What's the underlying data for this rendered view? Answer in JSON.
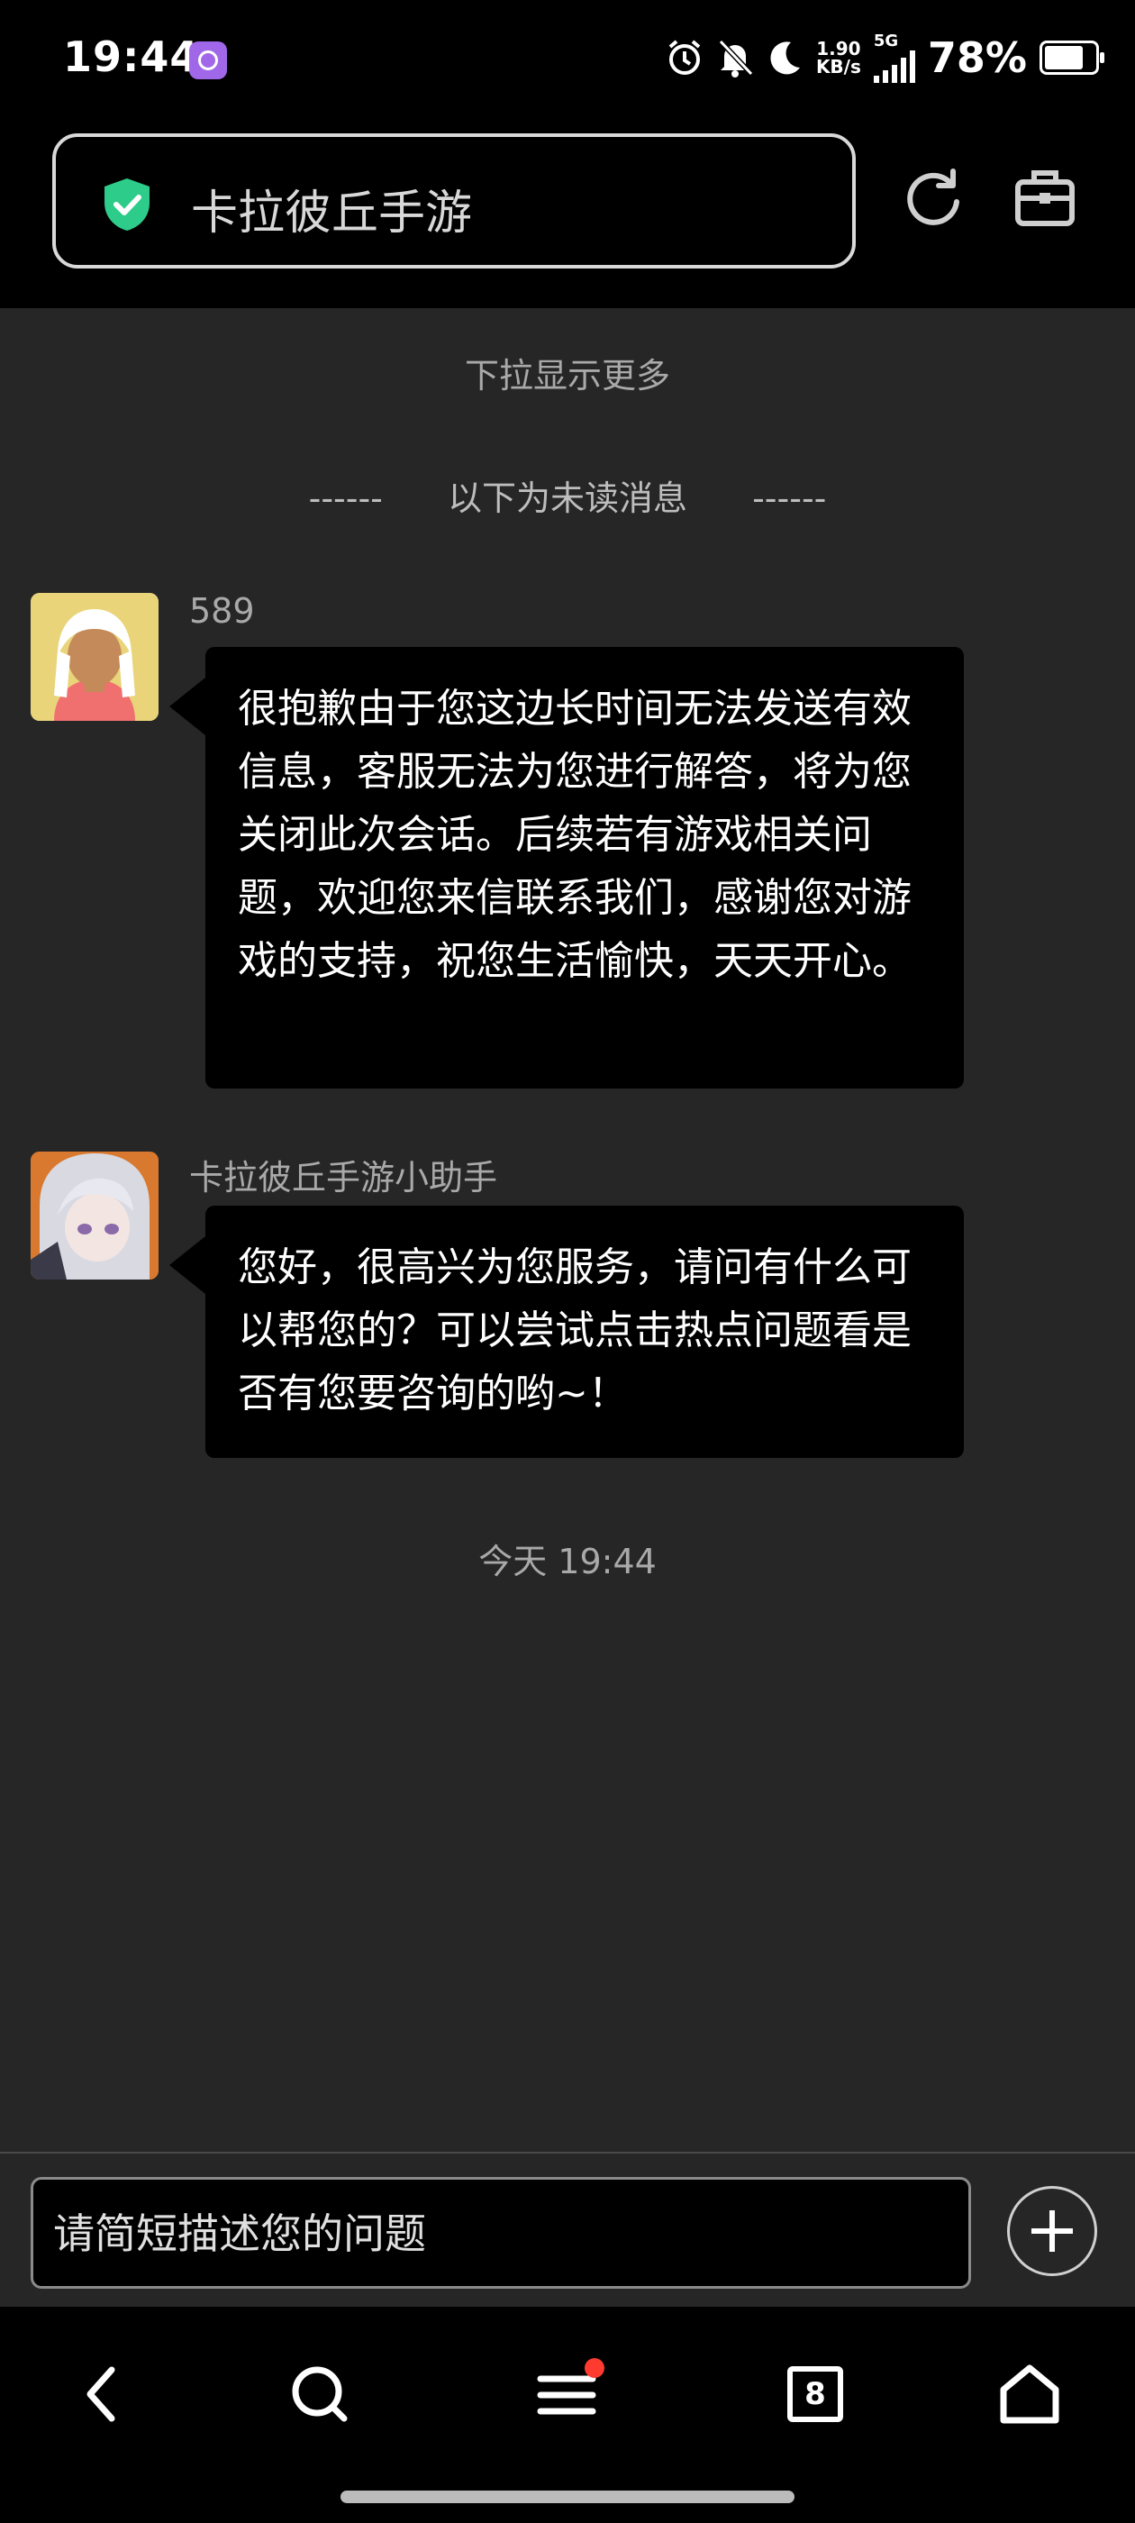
{
  "status_bar": {
    "time": "19:44",
    "net_speed_value": "1.90",
    "net_speed_unit": "KB/s",
    "network_type": "5G",
    "battery": "78%",
    "icons": [
      "app-icon",
      "alarm-icon",
      "mute-bell-icon",
      "moon-icon",
      "signal-icon",
      "battery-icon"
    ]
  },
  "address_bar": {
    "title": "卡拉彼丘手游",
    "shield_color": "#2ecc8a"
  },
  "chat": {
    "pull_more": "下拉显示更多",
    "unread_dashes": "------",
    "unread_label": "以下为未读消息",
    "messages": [
      {
        "sender": "589",
        "text": "很抱歉由于您这边长时间无法发送有效信息，客服无法为您进行解答，将为您关闭此次会话。后续若有游戏相关问题，欢迎您来信联系我们，感谢您对游戏的支持，祝您生活愉快，天天开心。"
      },
      {
        "sender": "卡拉彼丘手游小助手",
        "text": "您好，很高兴为您服务，请问有什么可以帮您的？可以尝试点击热点问题看是否有您要咨询的哟~！"
      }
    ],
    "timestamp": "今天 19:44"
  },
  "input": {
    "placeholder": "请简短描述您的问题"
  },
  "bottom_nav": {
    "tab_count": "8",
    "icons": [
      "back-icon",
      "search-icon",
      "menu-icon",
      "tabs-icon",
      "home-icon"
    ],
    "notification_color": "#ff3b30"
  }
}
